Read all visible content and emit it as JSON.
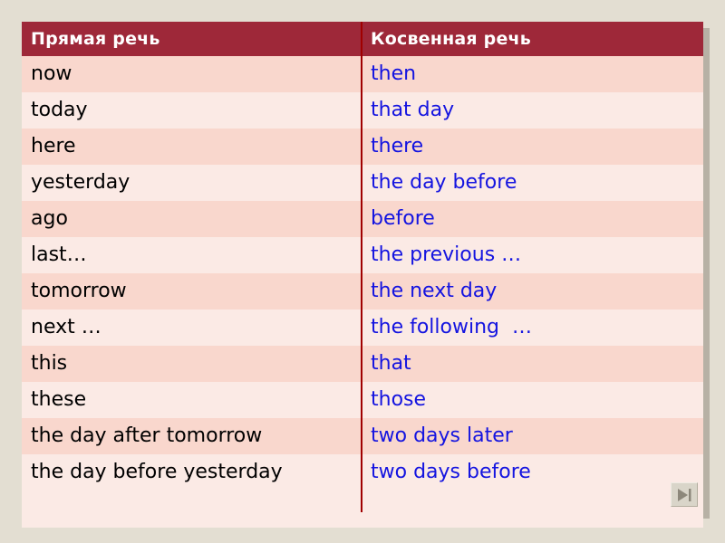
{
  "slide": {
    "background_color": "#e3ded2",
    "accent_color": "#9e2839",
    "divider_color": "#a00000",
    "direct_text_color": "#000000",
    "reported_text_color": "#1414e0",
    "row_color_odd": "#f9d7cd",
    "row_color_even": "#fbeae5"
  },
  "table": {
    "headers": {
      "direct": "Прямая речь",
      "reported": "Косвенная речь"
    },
    "rows": [
      {
        "direct": "now",
        "reported": "then"
      },
      {
        "direct": "today",
        "reported": "that day"
      },
      {
        "direct": "here",
        "reported": "there"
      },
      {
        "direct": "yesterday",
        "reported": "the day before"
      },
      {
        "direct": "ago",
        "reported": "before"
      },
      {
        "direct": "last…",
        "reported": "the previous …"
      },
      {
        "direct": "tomorrow",
        "reported": "the next day"
      },
      {
        "direct": "next …",
        "reported": "the following  …"
      },
      {
        "direct": "this",
        "reported": "that"
      },
      {
        "direct": "these",
        "reported": "those"
      },
      {
        "direct": "the day after tomorrow",
        "reported": "two days later"
      },
      {
        "direct": "the day before yesterday",
        "reported": "two days before"
      }
    ]
  },
  "controls": {
    "next_slide_label": "next-slide",
    "next_slide_icon": "skip-forward-icon"
  }
}
